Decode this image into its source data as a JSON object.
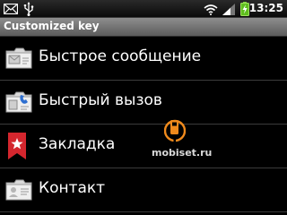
{
  "status_bar": {
    "time": "13:25",
    "icons": [
      "envelope-icon",
      "usb-icon",
      "wifi-icon",
      "signal-icon",
      "battery-charging-icon"
    ]
  },
  "title_bar": {
    "title": "Customized key"
  },
  "list": {
    "items": [
      {
        "label": "Быстрое сообщение",
        "icon": "quick-message-icon"
      },
      {
        "label": "Быстрый вызов",
        "icon": "quick-call-icon"
      },
      {
        "label": "Закладка",
        "icon": "bookmark-icon"
      },
      {
        "label": "Контакт",
        "icon": "contact-icon"
      }
    ]
  },
  "watermark": {
    "text": "mobiset.ru",
    "accent_color": "#f08a1c"
  },
  "colors": {
    "title_bar": "#7a7a7a",
    "background": "#000000",
    "bookmark_red": "#d4262e"
  }
}
